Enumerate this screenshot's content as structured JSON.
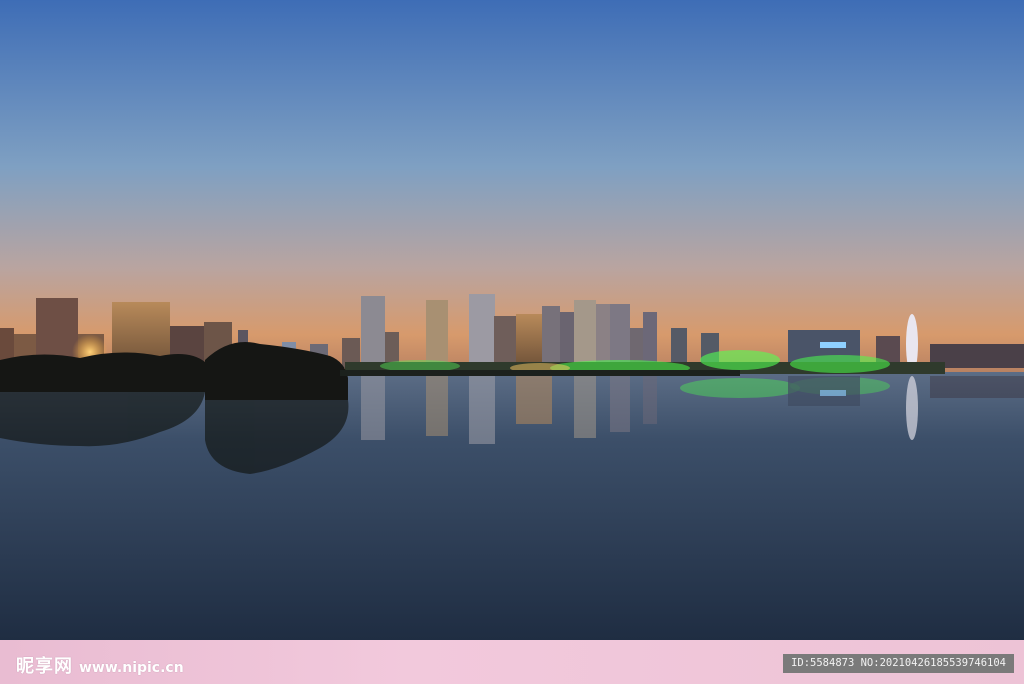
{
  "watermark": {
    "brand": "昵享网",
    "url": "www.nipic.cn",
    "id_text": "ID:5584873 NO:20210426185539746104"
  },
  "colors": {
    "sky_top": "#3f6fb7",
    "sky_horizon": "#d79a6c",
    "water": "#2a3b52",
    "green_lights": "#4bff4b",
    "footer": "#efc4d8"
  }
}
